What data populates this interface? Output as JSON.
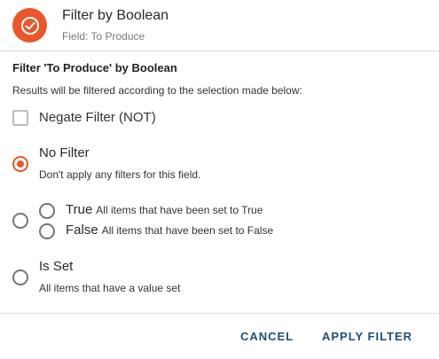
{
  "header": {
    "title": "Filter by Boolean",
    "subtitle": "Field: To Produce",
    "icon": "check-circle-icon",
    "accent_color": "#e8572e"
  },
  "section": {
    "title": "Filter 'To Produce' by Boolean",
    "description": "Results will be filtered according to the selection made below:"
  },
  "negate": {
    "label": "Negate Filter (NOT)",
    "checked": false
  },
  "options": {
    "no_filter": {
      "label": "No Filter",
      "description": "Don't apply any filters for this field.",
      "selected": true
    },
    "value": {
      "selected": false,
      "true_label": "True",
      "true_desc": "All items that have been set to True",
      "false_label": "False",
      "false_desc": "All items that have been set to False"
    },
    "is_set": {
      "label": "Is Set",
      "description": "All items that have a value set",
      "selected": false
    }
  },
  "actions": {
    "cancel": "CANCEL",
    "apply": "APPLY FILTER"
  }
}
